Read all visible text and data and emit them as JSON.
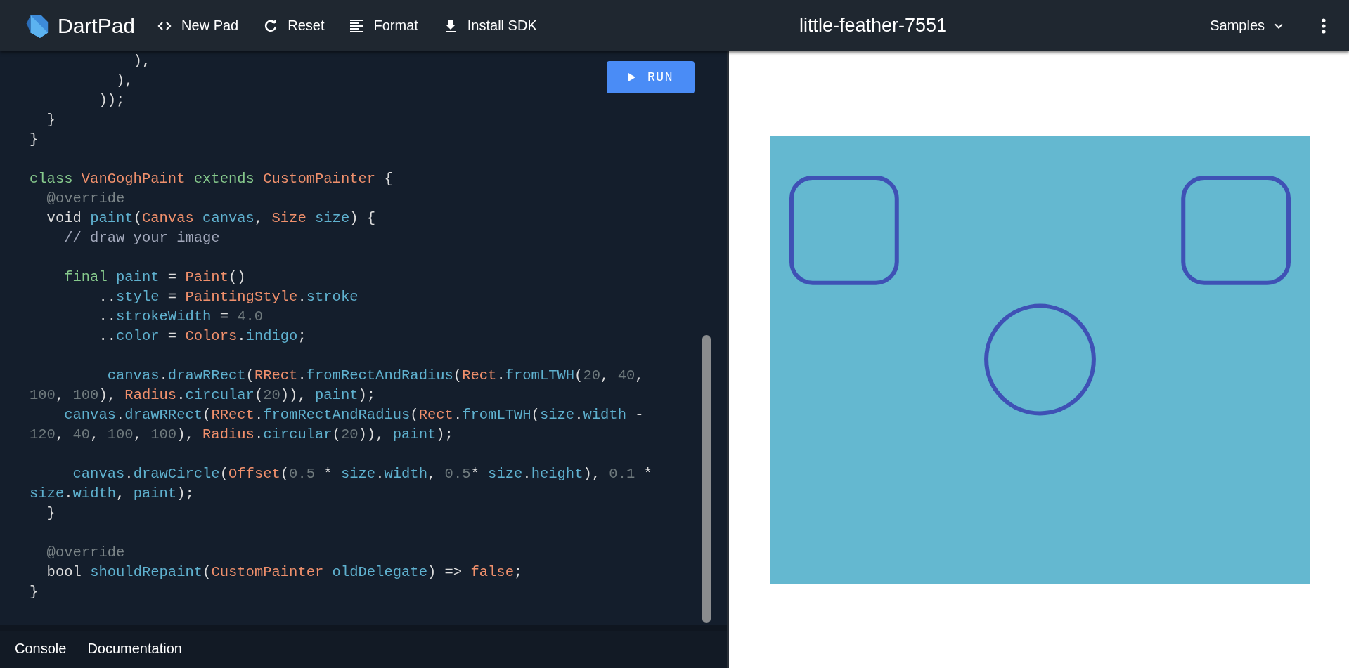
{
  "app": {
    "name": "DartPad"
  },
  "toolbar": [
    {
      "kind": "code",
      "label": "New Pad"
    },
    {
      "kind": "refresh",
      "label": "Reset"
    },
    {
      "kind": "format",
      "label": "Format"
    },
    {
      "kind": "download",
      "label": "Install SDK"
    }
  ],
  "pad_title": "little-feather-7551",
  "samples_menu": {
    "label": "Samples"
  },
  "editor": {
    "run_button": "RUN",
    "blocks": [
      {
        "lines": [
          [
            {
              "kind": "plain",
              "text": "            ),"
            }
          ],
          [
            {
              "kind": "plain",
              "text": "          ),"
            }
          ],
          [
            {
              "kind": "plain",
              "text": "        ));"
            }
          ],
          [
            {
              "kind": "plain",
              "text": "  }"
            }
          ],
          [
            {
              "kind": "plain",
              "text": "}"
            }
          ]
        ]
      },
      {
        "lines": [
          [
            {
              "kind": "keyword",
              "text": "class "
            },
            {
              "kind": "type",
              "text": "VanGoghPaint "
            },
            {
              "kind": "keyword",
              "text": "extends "
            },
            {
              "kind": "type",
              "text": "CustomPainter "
            },
            {
              "kind": "plain",
              "text": "{"
            }
          ],
          [
            {
              "kind": "annotation",
              "text": "  @override"
            }
          ],
          [
            {
              "kind": "plain",
              "text": "  void "
            },
            {
              "kind": "ident",
              "text": "paint"
            },
            {
              "kind": "plain",
              "text": "("
            },
            {
              "kind": "type",
              "text": "Canvas "
            },
            {
              "kind": "ident",
              "text": "canvas"
            },
            {
              "kind": "plain",
              "text": ", "
            },
            {
              "kind": "type",
              "text": "Size "
            },
            {
              "kind": "ident",
              "text": "size"
            },
            {
              "kind": "plain",
              "text": ") {"
            }
          ],
          [
            {
              "kind": "comment",
              "text": "    // draw your image"
            }
          ]
        ]
      },
      {
        "lines": [
          [
            {
              "kind": "keyword",
              "text": "    final "
            },
            {
              "kind": "ident",
              "text": "paint "
            },
            {
              "kind": "plain",
              "text": "= "
            },
            {
              "kind": "type",
              "text": "Paint"
            },
            {
              "kind": "plain",
              "text": "()"
            }
          ],
          [
            {
              "kind": "plain",
              "text": "        .."
            },
            {
              "kind": "ident",
              "text": "style "
            },
            {
              "kind": "plain",
              "text": "= "
            },
            {
              "kind": "type",
              "text": "PaintingStyle"
            },
            {
              "kind": "plain",
              "text": "."
            },
            {
              "kind": "ident",
              "text": "stroke"
            }
          ],
          [
            {
              "kind": "plain",
              "text": "        .."
            },
            {
              "kind": "ident",
              "text": "strokeWidth "
            },
            {
              "kind": "plain",
              "text": "= "
            },
            {
              "kind": "number",
              "text": "4.0"
            }
          ],
          [
            {
              "kind": "plain",
              "text": "        .."
            },
            {
              "kind": "ident",
              "text": "color "
            },
            {
              "kind": "plain",
              "text": "= "
            },
            {
              "kind": "type",
              "text": "Colors"
            },
            {
              "kind": "plain",
              "text": "."
            },
            {
              "kind": "ident",
              "text": "indigo"
            },
            {
              "kind": "plain",
              "text": ";"
            }
          ]
        ]
      },
      {
        "lines": [
          [
            {
              "kind": "ident",
              "text": "         canvas"
            },
            {
              "kind": "plain",
              "text": "."
            },
            {
              "kind": "ident",
              "text": "drawRRect"
            },
            {
              "kind": "plain",
              "text": "("
            },
            {
              "kind": "type",
              "text": "RRect"
            },
            {
              "kind": "plain",
              "text": "."
            },
            {
              "kind": "ident",
              "text": "fromRectAndRadius"
            },
            {
              "kind": "plain",
              "text": "("
            },
            {
              "kind": "type",
              "text": "Rect"
            },
            {
              "kind": "plain",
              "text": "."
            },
            {
              "kind": "ident",
              "text": "fromLTWH"
            },
            {
              "kind": "plain",
              "text": "("
            },
            {
              "kind": "number",
              "text": "20"
            },
            {
              "kind": "plain",
              "text": ", "
            },
            {
              "kind": "number",
              "text": "40"
            },
            {
              "kind": "plain",
              "text": ","
            }
          ],
          [
            {
              "kind": "number",
              "text": "100"
            },
            {
              "kind": "plain",
              "text": ", "
            },
            {
              "kind": "number",
              "text": "100"
            },
            {
              "kind": "plain",
              "text": "), "
            },
            {
              "kind": "type",
              "text": "Radius"
            },
            {
              "kind": "plain",
              "text": "."
            },
            {
              "kind": "ident",
              "text": "circular"
            },
            {
              "kind": "plain",
              "text": "("
            },
            {
              "kind": "number",
              "text": "20"
            },
            {
              "kind": "plain",
              "text": ")), "
            },
            {
              "kind": "ident",
              "text": "paint"
            },
            {
              "kind": "plain",
              "text": ");"
            }
          ],
          [
            {
              "kind": "ident",
              "text": "    canvas"
            },
            {
              "kind": "plain",
              "text": "."
            },
            {
              "kind": "ident",
              "text": "drawRRect"
            },
            {
              "kind": "plain",
              "text": "("
            },
            {
              "kind": "type",
              "text": "RRect"
            },
            {
              "kind": "plain",
              "text": "."
            },
            {
              "kind": "ident",
              "text": "fromRectAndRadius"
            },
            {
              "kind": "plain",
              "text": "("
            },
            {
              "kind": "type",
              "text": "Rect"
            },
            {
              "kind": "plain",
              "text": "."
            },
            {
              "kind": "ident",
              "text": "fromLTWH"
            },
            {
              "kind": "plain",
              "text": "("
            },
            {
              "kind": "ident",
              "text": "size"
            },
            {
              "kind": "plain",
              "text": "."
            },
            {
              "kind": "ident",
              "text": "width "
            },
            {
              "kind": "plain",
              "text": "-"
            }
          ],
          [
            {
              "kind": "number",
              "text": "120"
            },
            {
              "kind": "plain",
              "text": ", "
            },
            {
              "kind": "number",
              "text": "40"
            },
            {
              "kind": "plain",
              "text": ", "
            },
            {
              "kind": "number",
              "text": "100"
            },
            {
              "kind": "plain",
              "text": ", "
            },
            {
              "kind": "number",
              "text": "100"
            },
            {
              "kind": "plain",
              "text": "), "
            },
            {
              "kind": "type",
              "text": "Radius"
            },
            {
              "kind": "plain",
              "text": "."
            },
            {
              "kind": "ident",
              "text": "circular"
            },
            {
              "kind": "plain",
              "text": "("
            },
            {
              "kind": "number",
              "text": "20"
            },
            {
              "kind": "plain",
              "text": ")), "
            },
            {
              "kind": "ident",
              "text": "paint"
            },
            {
              "kind": "plain",
              "text": ");"
            }
          ]
        ]
      },
      {
        "lines": [
          [
            {
              "kind": "ident",
              "text": "     canvas"
            },
            {
              "kind": "plain",
              "text": "."
            },
            {
              "kind": "ident",
              "text": "drawCircle"
            },
            {
              "kind": "plain",
              "text": "("
            },
            {
              "kind": "type",
              "text": "Offset"
            },
            {
              "kind": "plain",
              "text": "("
            },
            {
              "kind": "number",
              "text": "0.5"
            },
            {
              "kind": "plain",
              "text": " * "
            },
            {
              "kind": "ident",
              "text": "size"
            },
            {
              "kind": "plain",
              "text": "."
            },
            {
              "kind": "ident",
              "text": "width"
            },
            {
              "kind": "plain",
              "text": ", "
            },
            {
              "kind": "number",
              "text": "0.5"
            },
            {
              "kind": "plain",
              "text": "* "
            },
            {
              "kind": "ident",
              "text": "size"
            },
            {
              "kind": "plain",
              "text": "."
            },
            {
              "kind": "ident",
              "text": "height"
            },
            {
              "kind": "plain",
              "text": "), "
            },
            {
              "kind": "number",
              "text": "0.1"
            },
            {
              "kind": "plain",
              "text": " *"
            }
          ],
          [
            {
              "kind": "ident",
              "text": "size"
            },
            {
              "kind": "plain",
              "text": "."
            },
            {
              "kind": "ident",
              "text": "width"
            },
            {
              "kind": "plain",
              "text": ", "
            },
            {
              "kind": "ident",
              "text": "paint"
            },
            {
              "kind": "plain",
              "text": ");"
            }
          ],
          [
            {
              "kind": "plain",
              "text": "  }"
            }
          ]
        ]
      },
      {
        "lines": [
          [
            {
              "kind": "annotation",
              "text": "  @override"
            }
          ],
          [
            {
              "kind": "plain",
              "text": "  bool "
            },
            {
              "kind": "ident",
              "text": "shouldRepaint"
            },
            {
              "kind": "plain",
              "text": "("
            },
            {
              "kind": "type",
              "text": "CustomPainter "
            },
            {
              "kind": "ident",
              "text": "oldDelegate"
            },
            {
              "kind": "plain",
              "text": ") => "
            },
            {
              "kind": "type",
              "text": "false"
            },
            {
              "kind": "plain",
              "text": ";"
            }
          ],
          [
            {
              "kind": "plain",
              "text": "}"
            }
          ]
        ]
      }
    ]
  },
  "bottom_tabs": [
    {
      "label": "Console",
      "selected": false
    },
    {
      "label": "Documentation",
      "selected": false
    }
  ]
}
